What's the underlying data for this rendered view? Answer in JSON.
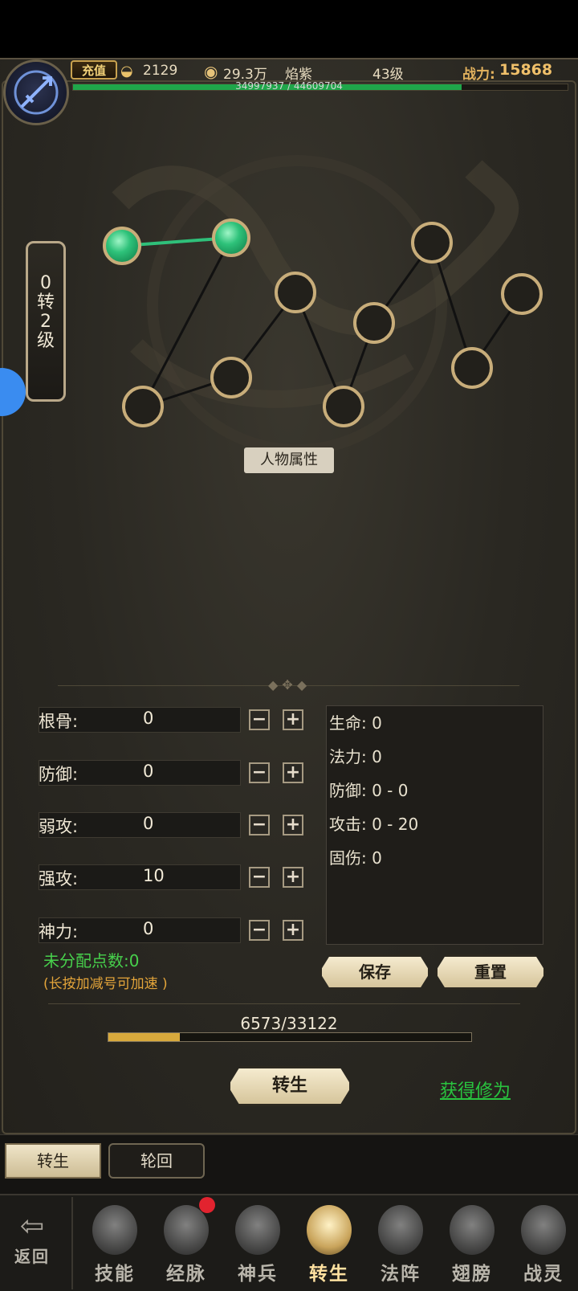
{
  "topbar": {
    "recharge_label": "充值",
    "ingots": "2129",
    "coins": "29.3万",
    "player_name": "焰紫",
    "level": "43级",
    "power_label": "战力:",
    "power_value": "15868",
    "exp_text": "34997937 / 44609704",
    "exp_fraction": 0.785
  },
  "rebirth_level": {
    "line1": "0",
    "line2": "转",
    "line3": "2",
    "line4": "级"
  },
  "attr_section_label": "人物属性",
  "stats": [
    {
      "label": "根骨:",
      "value": "0"
    },
    {
      "label": "防御:",
      "value": "0"
    },
    {
      "label": "弱攻:",
      "value": "0"
    },
    {
      "label": "强攻:",
      "value": "10"
    },
    {
      "label": "神力:",
      "value": "0"
    }
  ],
  "minus_symbol": "−",
  "plus_symbol": "+",
  "attributes": [
    "生命: 0",
    "法力: 0",
    "防御: 0 - 0",
    "攻击: 0 - 20",
    "固伤: 0"
  ],
  "unassigned_points": "未分配点数:0",
  "hint": "(长按加减号可加速 )",
  "save_label": "保存",
  "reset_label": "重置",
  "progress": {
    "text": "6573/33122",
    "fraction": 0.198
  },
  "rebirth_button": "转生",
  "gain_link": "获得修为",
  "tabs": [
    "转生",
    "轮回"
  ],
  "nav": {
    "back": "返回",
    "items": [
      "技能",
      "经脉",
      "神兵",
      "转生",
      "法阵",
      "翅膀",
      "战灵"
    ],
    "active": "转生"
  },
  "colors": {
    "accent_gold": "#c8ad7a",
    "active_node": "#2ec27a",
    "exp_bar": "#1fa64a",
    "progress_bar": "#d8a93c",
    "link_green": "#29c43f",
    "notification_red": "#e2232f"
  }
}
